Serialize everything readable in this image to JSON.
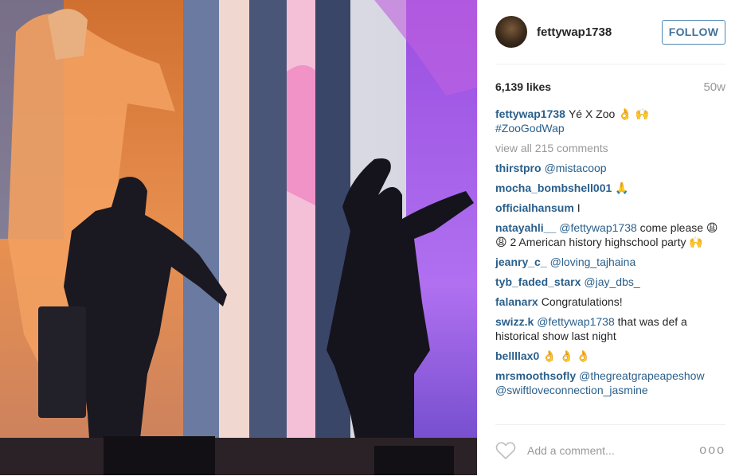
{
  "post": {
    "username": "fettywap1738",
    "follow_label": "FOLLOW",
    "likes": "6,139 likes",
    "age": "50w"
  },
  "caption": {
    "username": "fettywap1738",
    "text": "Yé X Zoo 👌 🙌",
    "hashtag": "#ZooGodWap"
  },
  "view_all": "view all 215 comments",
  "comments": [
    {
      "user": "thirstpro",
      "mention": "@mistacoop",
      "text": ""
    },
    {
      "user": "mocha_bombshell001",
      "mention": "",
      "text": "🙏"
    },
    {
      "user": "officialhansum",
      "mention": "",
      "text": "I"
    },
    {
      "user": "natayahli__",
      "mention": "@fettywap1738",
      "text": "come please 😩 😩  2 American history highschool party 🙌"
    },
    {
      "user": "jeanry_c_",
      "mention": "@loving_tajhaina",
      "text": ""
    },
    {
      "user": "tyb_faded_starx",
      "mention": "@jay_dbs_",
      "text": ""
    },
    {
      "user": "falanarx",
      "mention": "",
      "text": "Congratulations!"
    },
    {
      "user": "swizz.k",
      "mention": "@fettywap1738",
      "text": "that was def a historical show last night"
    },
    {
      "user": "bellllax0",
      "mention": "",
      "text": "👌 👌 👌"
    },
    {
      "user": "mrsmoothsofly",
      "mention": "@thegreatgrapeapeshow @swiftloveconnection_jasmine",
      "text": ""
    }
  ],
  "footer": {
    "add_comment_placeholder": "Add a comment...",
    "more_label": "ooo"
  },
  "icons": {
    "like": "heart-icon",
    "options": "more-options-icon"
  },
  "colors": {
    "link": "#2a5f8b",
    "follow_border": "#4f87b5",
    "muted": "#999999"
  }
}
